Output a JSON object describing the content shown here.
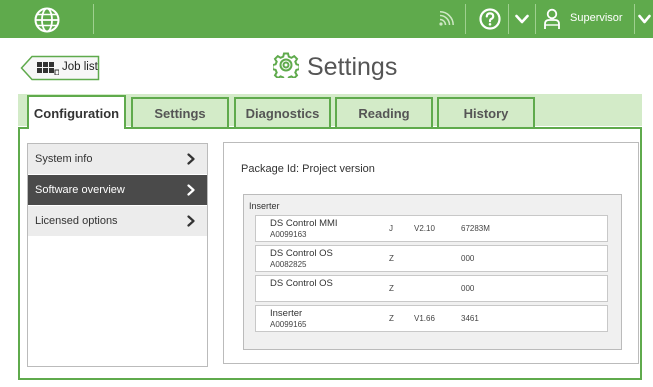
{
  "topbar": {
    "user_label": "Supervisor",
    "icons": [
      "globe-icon",
      "signal-icon",
      "help-icon",
      "chevron-down-icon",
      "user-icon",
      "chevron-down-icon"
    ]
  },
  "header": {
    "job_list_label": "Job list",
    "title": "Settings"
  },
  "tabs": [
    {
      "label": "Configuration",
      "active": true
    },
    {
      "label": "Settings",
      "active": false
    },
    {
      "label": "Diagnostics",
      "active": false
    },
    {
      "label": "Reading",
      "active": false
    },
    {
      "label": "History",
      "active": false
    }
  ],
  "menu": [
    {
      "label": "System info",
      "selected": false
    },
    {
      "label": "Software overview",
      "selected": true
    },
    {
      "label": "Licensed options",
      "selected": false
    }
  ],
  "detail": {
    "package_title": "Package Id: Project version",
    "group_label": "Inserter",
    "rows": [
      {
        "name": "DS Control MMI",
        "code": "A0099163",
        "letter": "J",
        "version": "V2.10",
        "number": "67283M"
      },
      {
        "name": "DS Control OS",
        "code": "A0082825",
        "letter": "Z",
        "version": "",
        "number": "000"
      },
      {
        "name": "DS Control OS",
        "code": "",
        "letter": "Z",
        "version": "",
        "number": "000"
      },
      {
        "name": "Inserter",
        "code": "A0099165",
        "letter": "Z",
        "version": "V1.66",
        "number": "3461"
      }
    ]
  },
  "colors": {
    "brand_green": "#5faa4c",
    "tab_inactive": "#d3ebc8",
    "menu_selected": "#4a4a4a"
  }
}
